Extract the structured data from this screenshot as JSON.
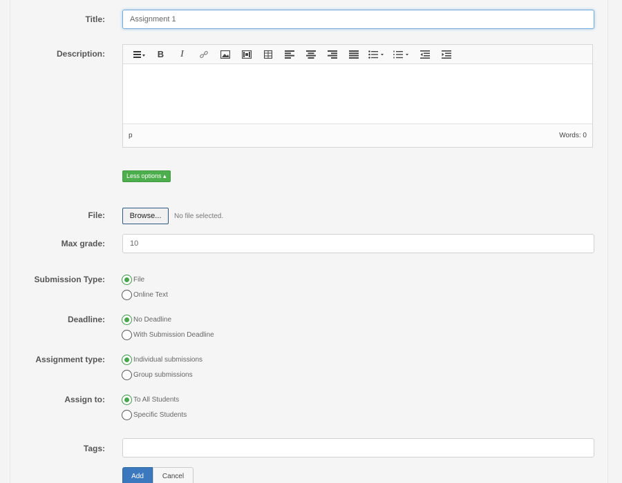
{
  "form": {
    "title": {
      "label": "Title:",
      "value": "Assignment 1"
    },
    "description": {
      "label": "Description:",
      "toolbar": [
        {
          "icon": "format-icon"
        },
        {
          "icon": "bold-icon",
          "text": "B"
        },
        {
          "icon": "italic-icon",
          "text": "I"
        },
        {
          "icon": "link-icon"
        },
        {
          "icon": "image-icon"
        },
        {
          "icon": "media-icon"
        },
        {
          "icon": "table-icon"
        },
        {
          "icon": "align-left-icon"
        },
        {
          "icon": "align-center-icon"
        },
        {
          "icon": "align-right-icon"
        },
        {
          "icon": "align-justify-icon"
        },
        {
          "icon": "bullet-list-icon"
        },
        {
          "icon": "numbered-list-icon"
        },
        {
          "icon": "outdent-icon"
        },
        {
          "icon": "indent-icon"
        }
      ],
      "path": "p",
      "word_count": "Words: 0"
    },
    "less_options_label": "Less options ▴",
    "file": {
      "label": "File:",
      "browse_label": "Browse...",
      "status": "No file selected."
    },
    "max_grade": {
      "label": "Max grade:",
      "value": "10"
    },
    "submission_type": {
      "label": "Submission Type:",
      "options": [
        {
          "label": "File",
          "checked": true
        },
        {
          "label": "Online Text",
          "checked": false
        }
      ]
    },
    "deadline": {
      "label": "Deadline:",
      "options": [
        {
          "label": "No Deadline",
          "checked": true
        },
        {
          "label": "With Submission Deadline",
          "checked": false
        }
      ]
    },
    "assignment_type": {
      "label": "Assignment type:",
      "options": [
        {
          "label": "Individual submissions",
          "checked": true
        },
        {
          "label": "Group submissions",
          "checked": false
        }
      ]
    },
    "assign_to": {
      "label": "Assign to:",
      "options": [
        {
          "label": "To All Students",
          "checked": true
        },
        {
          "label": "Specific Students",
          "checked": false
        }
      ]
    },
    "tags": {
      "label": "Tags:",
      "value": ""
    },
    "actions": {
      "add_label": "Add",
      "cancel_label": "Cancel"
    }
  },
  "colors": {
    "primary": "#3b78bd",
    "success": "#4cae4c",
    "radio_checked": "#47a64b",
    "focus_border": "#74a9de"
  }
}
